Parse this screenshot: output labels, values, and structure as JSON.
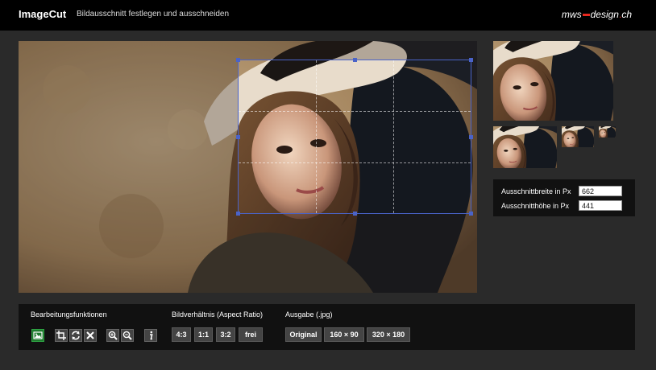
{
  "header": {
    "app_title": "ImageCut",
    "subtitle": "Bildausschnitt festlegen und ausschneiden",
    "brand_left": "mws",
    "brand_mid": "design",
    "brand_dot": ".",
    "brand_tld": "ch"
  },
  "crop": {
    "width_label": "Ausschnittbreite in Px",
    "width_value": "662",
    "height_label": "Ausschnitthöhe in Px",
    "height_value": "441"
  },
  "toolbar": {
    "edit_label": "Bearbeitungsfunktionen",
    "edit_icons": [
      "image-icon",
      "crop-icon",
      "rotate-icon",
      "close-icon",
      "zoom-in-icon",
      "zoom-out-icon",
      "info-icon"
    ],
    "ratio_label": "Bildverhältnis (Aspect Ratio)",
    "ratios": [
      "4:3",
      "1:1",
      "3:2",
      "frei"
    ],
    "output_label": "Ausgabe (.jpg)",
    "outputs": [
      "Original",
      "160 × 90",
      "320 × 180"
    ]
  },
  "colors": {
    "header_bg": "#000000",
    "page_bg": "#2a2a2a",
    "crop_border": "#4a63c8",
    "brand_accent": "#e8281e",
    "active_button": "#1f7a2f"
  }
}
